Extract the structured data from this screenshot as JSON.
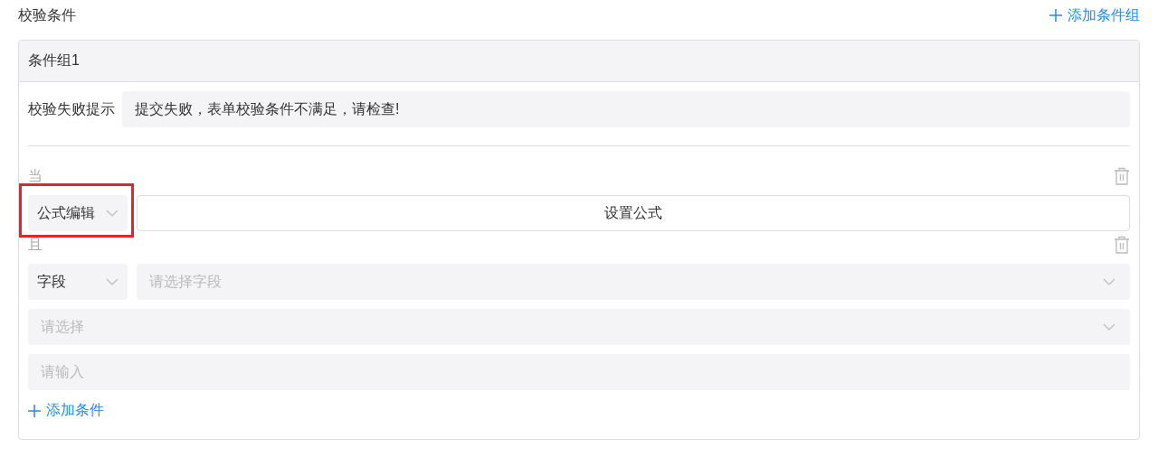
{
  "section": {
    "title": "校验条件",
    "add_group": "添加条件组"
  },
  "groups": [
    {
      "title": "条件组1",
      "fail_label": "校验失败提示",
      "fail_message": "提交失败，表单校验条件不满足，请检查!",
      "conditions": [
        {
          "connector": "当",
          "kind": "formula",
          "mode": "公式编辑",
          "highlighted": true,
          "button": "设置公式"
        },
        {
          "connector": "且",
          "kind": "field",
          "mode": "字段",
          "highlighted": false,
          "field_placeholder": "请选择字段",
          "operator_placeholder": "请选择",
          "value_placeholder": "请输入"
        }
      ],
      "add_condition": "添加条件"
    }
  ]
}
